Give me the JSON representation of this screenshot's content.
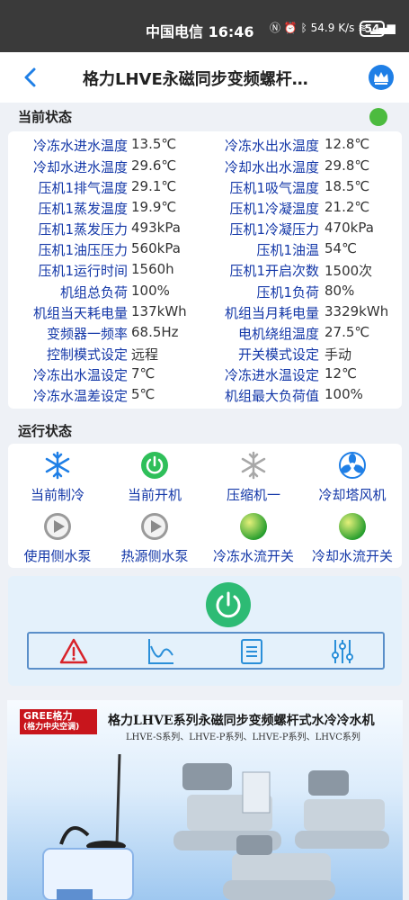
{
  "statusbar": {
    "carrier": "中国电信",
    "time": "16:46",
    "net_speed": "54.9 K/s",
    "battery": "54"
  },
  "header": {
    "title": "格力LHVE永磁同步变频螺杆…"
  },
  "current_status": {
    "label": "当前状态",
    "indicator_color": "#4cbb3f",
    "rows": [
      {
        "l1": "冷冻水进水温度",
        "v1": "13.5℃",
        "l2": "冷冻水出水温度",
        "v2": "12.8℃"
      },
      {
        "l1": "冷却水进水温度",
        "v1": "29.6℃",
        "l2": "冷却水出水温度",
        "v2": "29.8℃"
      },
      {
        "l1": "压机1排气温度",
        "v1": "29.1℃",
        "l2": "压机1吸气温度",
        "v2": "18.5℃"
      },
      {
        "l1": "压机1蒸发温度",
        "v1": "19.9℃",
        "l2": "压机1冷凝温度",
        "v2": "21.2℃"
      },
      {
        "l1": "压机1蒸发压力",
        "v1": "493kPa",
        "l2": "压机1冷凝压力",
        "v2": "470kPa"
      },
      {
        "l1": "压机1油压压力",
        "v1": "560kPa",
        "l2": "压机1油温",
        "v2": "54℃"
      },
      {
        "l1": "压机1运行时间",
        "v1": "1560h",
        "l2": "压机1开启次数",
        "v2": "1500次"
      },
      {
        "l1": "机组总负荷",
        "v1": "100%",
        "l2": "压机1负荷",
        "v2": "80%"
      },
      {
        "l1": "机组当天耗电量",
        "v1": "137kWh",
        "l2": "机组当月耗电量",
        "v2": "3329kWh"
      },
      {
        "l1": "变频器一频率",
        "v1": "68.5Hz",
        "l2": "电机绕组温度",
        "v2": "27.5℃"
      },
      {
        "l1": "控制模式设定",
        "v1": "远程",
        "l2": "开关模式设定",
        "v2": "手动"
      },
      {
        "l1": "冷冻出水温设定",
        "v1": "7℃",
        "l2": "冷冻进水温设定",
        "v2": "12℃"
      },
      {
        "l1": "冷冻水温差设定",
        "v1": "5℃",
        "l2": "机组最大负荷值",
        "v2": "100%"
      }
    ]
  },
  "run_status": {
    "label": "运行状态",
    "items": [
      {
        "label": "当前制冷",
        "icon": "snowflake-icon"
      },
      {
        "label": "当前开机",
        "icon": "power-icon"
      },
      {
        "label": "压缩机一",
        "icon": "snowflake-icon"
      },
      {
        "label": "冷却塔风机",
        "icon": "fan-icon"
      },
      {
        "label": "使用侧水泵",
        "icon": "pump-icon"
      },
      {
        "label": "热源侧水泵",
        "icon": "pump-icon"
      },
      {
        "label": "冷冻水流开关",
        "icon": "flow-switch-icon"
      },
      {
        "label": "冷却水流开关",
        "icon": "flow-switch-icon"
      }
    ]
  },
  "controls": {
    "power_color": "#2dbb74",
    "tools": [
      "alarm-icon",
      "curve-icon",
      "log-icon",
      "settings-icon"
    ]
  },
  "banner": {
    "logo_line1": "GREE格力",
    "logo_line2": "(格力中央空调)",
    "title": "格力LHVE系列永磁同步变频螺杆式水冷冷水机",
    "subtitle": "LHVE-S系列、LHVE-P系列、LHVE-P系列、LHVC系列"
  }
}
